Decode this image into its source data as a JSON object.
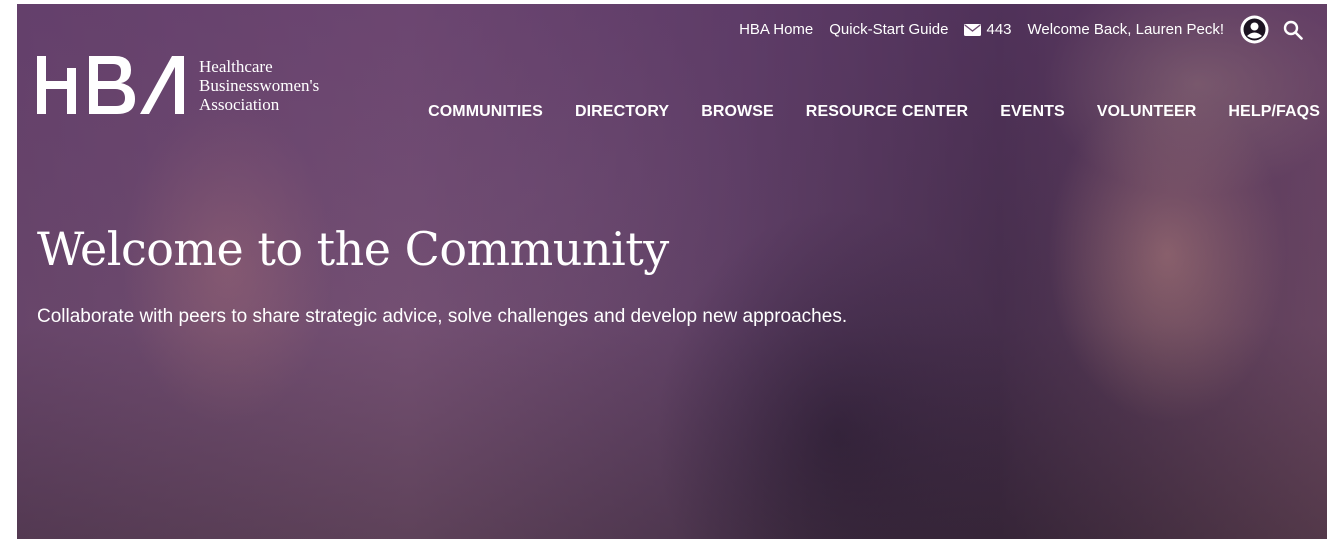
{
  "logo": {
    "mark": "HBA",
    "line1": "Healthcare",
    "line2": "Businesswomen's",
    "line3": "Association"
  },
  "utility": {
    "home": "HBA Home",
    "guide": "Quick-Start Guide",
    "messages_count": "443",
    "welcome": "Welcome Back, Lauren Peck!"
  },
  "nav": {
    "items": [
      {
        "label": "COMMUNITIES"
      },
      {
        "label": "DIRECTORY"
      },
      {
        "label": "BROWSE"
      },
      {
        "label": "RESOURCE CENTER"
      },
      {
        "label": "EVENTS"
      },
      {
        "label": "VOLUNTEER"
      },
      {
        "label": "HELP/FAQS"
      }
    ]
  },
  "hero": {
    "title": "Welcome to the Community",
    "subtitle": "Collaborate with peers to share strategic advice, solve challenges and develop new approaches."
  },
  "icons": {
    "mail": "envelope-icon",
    "user": "user-circle-icon",
    "search": "search-icon"
  }
}
